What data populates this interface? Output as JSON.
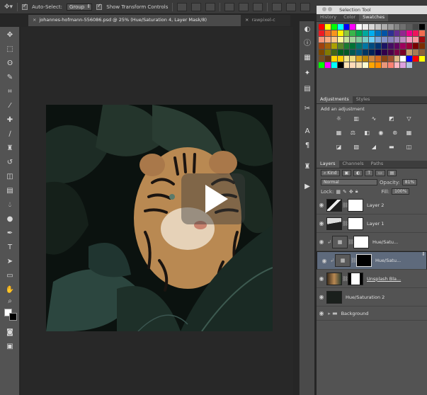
{
  "options_bar": {
    "auto_select_label": "Auto-Select:",
    "auto_select_value": "Group",
    "show_transform_label": "Show Transform Controls"
  },
  "tabs": [
    {
      "label": "johannes-hofmann-556086.psd @ 25% (Hue/Saturation 4, Layer Mask/8)",
      "active": true
    },
    {
      "label": "rawpixel-c",
      "active": false
    }
  ],
  "panels": {
    "window_title": "Selection Tool",
    "top_tabs": [
      "History",
      "Color",
      "Swatches"
    ],
    "active_top_tab": "Swatches",
    "swatch_colors": [
      "#ff0000",
      "#ffff00",
      "#00ff00",
      "#00ffff",
      "#0000ff",
      "#ff00ff",
      "#ffffff",
      "#ebebeb",
      "#d6d6d6",
      "#c2c2c2",
      "#adadad",
      "#999999",
      "#858585",
      "#707070",
      "#5c5c5c",
      "#474747",
      "#000000",
      "#ee1c24",
      "#f26522",
      "#f7941d",
      "#fff200",
      "#8dc63f",
      "#39b54a",
      "#00a651",
      "#00a99d",
      "#00aeef",
      "#0072bc",
      "#0054a6",
      "#2e3192",
      "#662d91",
      "#92278f",
      "#ec008c",
      "#ed145b",
      "#f26c4f",
      "#f69679",
      "#f9ad81",
      "#fdc68a",
      "#fff799",
      "#c4df9b",
      "#a3d39c",
      "#82ca9c",
      "#7accc8",
      "#6dcff6",
      "#7da7d9",
      "#8393ca",
      "#8781bd",
      "#a186be",
      "#bd8cbf",
      "#f49ac1",
      "#f5989d",
      "#9e0b0f",
      "#a0410d",
      "#a36209",
      "#aba000",
      "#598527",
      "#197b30",
      "#007236",
      "#00746b",
      "#0076a3",
      "#004b80",
      "#003471",
      "#1b1464",
      "#440e62",
      "#630460",
      "#9e005d",
      "#9e0039",
      "#790000",
      "#7b2e00",
      "#7d4900",
      "#827b00",
      "#406618",
      "#005e20",
      "#005826",
      "#005952",
      "#005b7f",
      "#003663",
      "#002157",
      "#0d004c",
      "#32004b",
      "#4b0049",
      "#7b0046",
      "#7a0026",
      "#c69c6d",
      "#a67c52",
      "#8c6239",
      "#754c24",
      "#603913",
      "#ffd700",
      "#ffcc00",
      "#f0e68c",
      "#eedd82",
      "#daa520",
      "#b8860b",
      "#cd853f",
      "#d2691e",
      "#8b4513",
      "#a0522d",
      "#deb887",
      "#ffffff",
      "#0000ff",
      "#ff0000",
      "#ffff00",
      "#00ff00",
      "#ff00ff",
      "#00ffff",
      "#000000",
      "#ffe4b5",
      "#ffdab9",
      "#f5deb3",
      "#fafad2",
      "#ffa500",
      "#ff8c00",
      "#e9967a",
      "#fa8072",
      "#ffb6c1",
      "#dda0dd",
      "#b0c4de"
    ],
    "adjustments_tabs": [
      "Adjustments",
      "Styles"
    ],
    "adjustments_title": "Add an adjustment",
    "layers_tabs": [
      "Layers",
      "Channels",
      "Paths"
    ],
    "kind_label": "Kind",
    "blend_mode": "Normal",
    "opacity_label": "Opacity:",
    "opacity_value": "81%",
    "lock_label": "Lock:",
    "fill_label": "Fill:",
    "fill_value": "100%",
    "layers": [
      {
        "name": "Layer 2",
        "type": "pixel",
        "selected": false
      },
      {
        "name": "Layer 1",
        "type": "pixel",
        "selected": false
      },
      {
        "name": "Hue/Satu...",
        "type": "adjustment",
        "selected": false
      },
      {
        "name": "Hue/Satu...",
        "type": "adjustment",
        "selected": true
      },
      {
        "name": "Unsplash Bla...",
        "type": "pixel",
        "selected": false
      },
      {
        "name": "Hue/Saturation 2",
        "type": "pixel",
        "selected": false
      },
      {
        "name": "Background",
        "type": "group",
        "selected": false
      }
    ]
  }
}
